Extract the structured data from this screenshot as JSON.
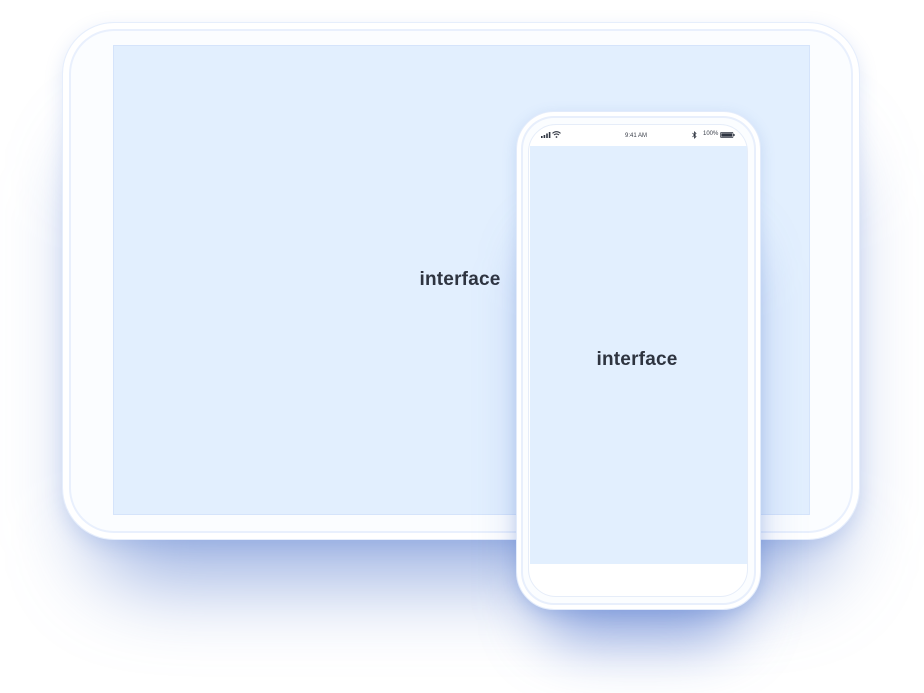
{
  "tablet": {
    "screen_label": "interface"
  },
  "phone": {
    "status_bar": {
      "time": "9:41 AM",
      "battery_percent": "100%",
      "signal_icon": "cellular-signal-icon",
      "wifi_icon": "wifi-icon",
      "bluetooth_icon": "bluetooth-icon",
      "battery_icon": "battery-icon"
    },
    "screen_label": "interface"
  },
  "colors": {
    "screen_fill": "#e2effe",
    "device_body": "#fbfdff",
    "label_text": "#2e3440",
    "shadow": "#466ec8"
  }
}
